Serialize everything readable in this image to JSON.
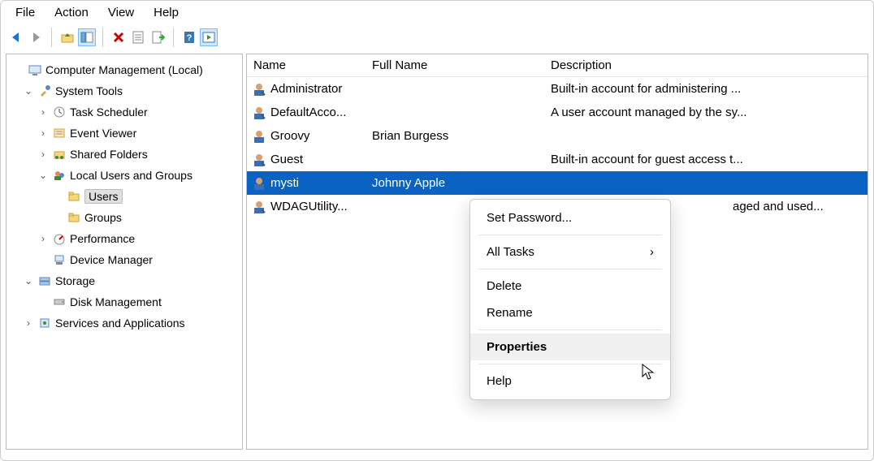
{
  "menu": {
    "file": "File",
    "action": "Action",
    "view": "View",
    "help": "Help"
  },
  "toolbar_icons": [
    "back",
    "forward",
    "folder-up",
    "show-hide",
    "delete",
    "properties",
    "export",
    "help",
    "action-pane"
  ],
  "tree": {
    "root": "Computer Management (Local)",
    "nodes": [
      {
        "label": "System Tools",
        "expanded": true,
        "icon": "tools"
      },
      {
        "label": "Task Scheduler",
        "expanded": false,
        "icon": "clock",
        "indent": 2
      },
      {
        "label": "Event Viewer",
        "expanded": false,
        "icon": "event",
        "indent": 2
      },
      {
        "label": "Shared Folders",
        "expanded": false,
        "icon": "shared",
        "indent": 2
      },
      {
        "label": "Local Users and Groups",
        "expanded": true,
        "icon": "users-groups",
        "indent": 2
      },
      {
        "label": "Users",
        "icon": "folder",
        "indent": 3,
        "selected": true
      },
      {
        "label": "Groups",
        "icon": "folder",
        "indent": 3
      },
      {
        "label": "Performance",
        "expanded": false,
        "icon": "perf",
        "indent": 2
      },
      {
        "label": "Device Manager",
        "icon": "device",
        "indent": 2
      },
      {
        "label": "Storage",
        "expanded": true,
        "icon": "storage",
        "indent": 1
      },
      {
        "label": "Disk Management",
        "icon": "disk",
        "indent": 2
      },
      {
        "label": "Services and Applications",
        "expanded": false,
        "icon": "services",
        "indent": 1
      }
    ]
  },
  "columns": {
    "name": "Name",
    "fullname": "Full Name",
    "description": "Description"
  },
  "users": [
    {
      "name": "Administrator",
      "fullname": "",
      "description": "Built-in account for administering ..."
    },
    {
      "name": "DefaultAcco...",
      "fullname": "",
      "description": "A user account managed by the sy..."
    },
    {
      "name": "Groovy",
      "fullname": "Brian Burgess",
      "description": ""
    },
    {
      "name": "Guest",
      "fullname": "",
      "description": "Built-in account for guest access t..."
    },
    {
      "name": "mysti",
      "fullname": "Johnny Apple",
      "description": "",
      "selected": true
    },
    {
      "name": "WDAGUtility...",
      "fullname": "",
      "description": "aged and used..."
    }
  ],
  "context_menu": {
    "set_password": "Set Password...",
    "all_tasks": "All Tasks",
    "delete": "Delete",
    "rename": "Rename",
    "properties": "Properties",
    "help": "Help"
  }
}
